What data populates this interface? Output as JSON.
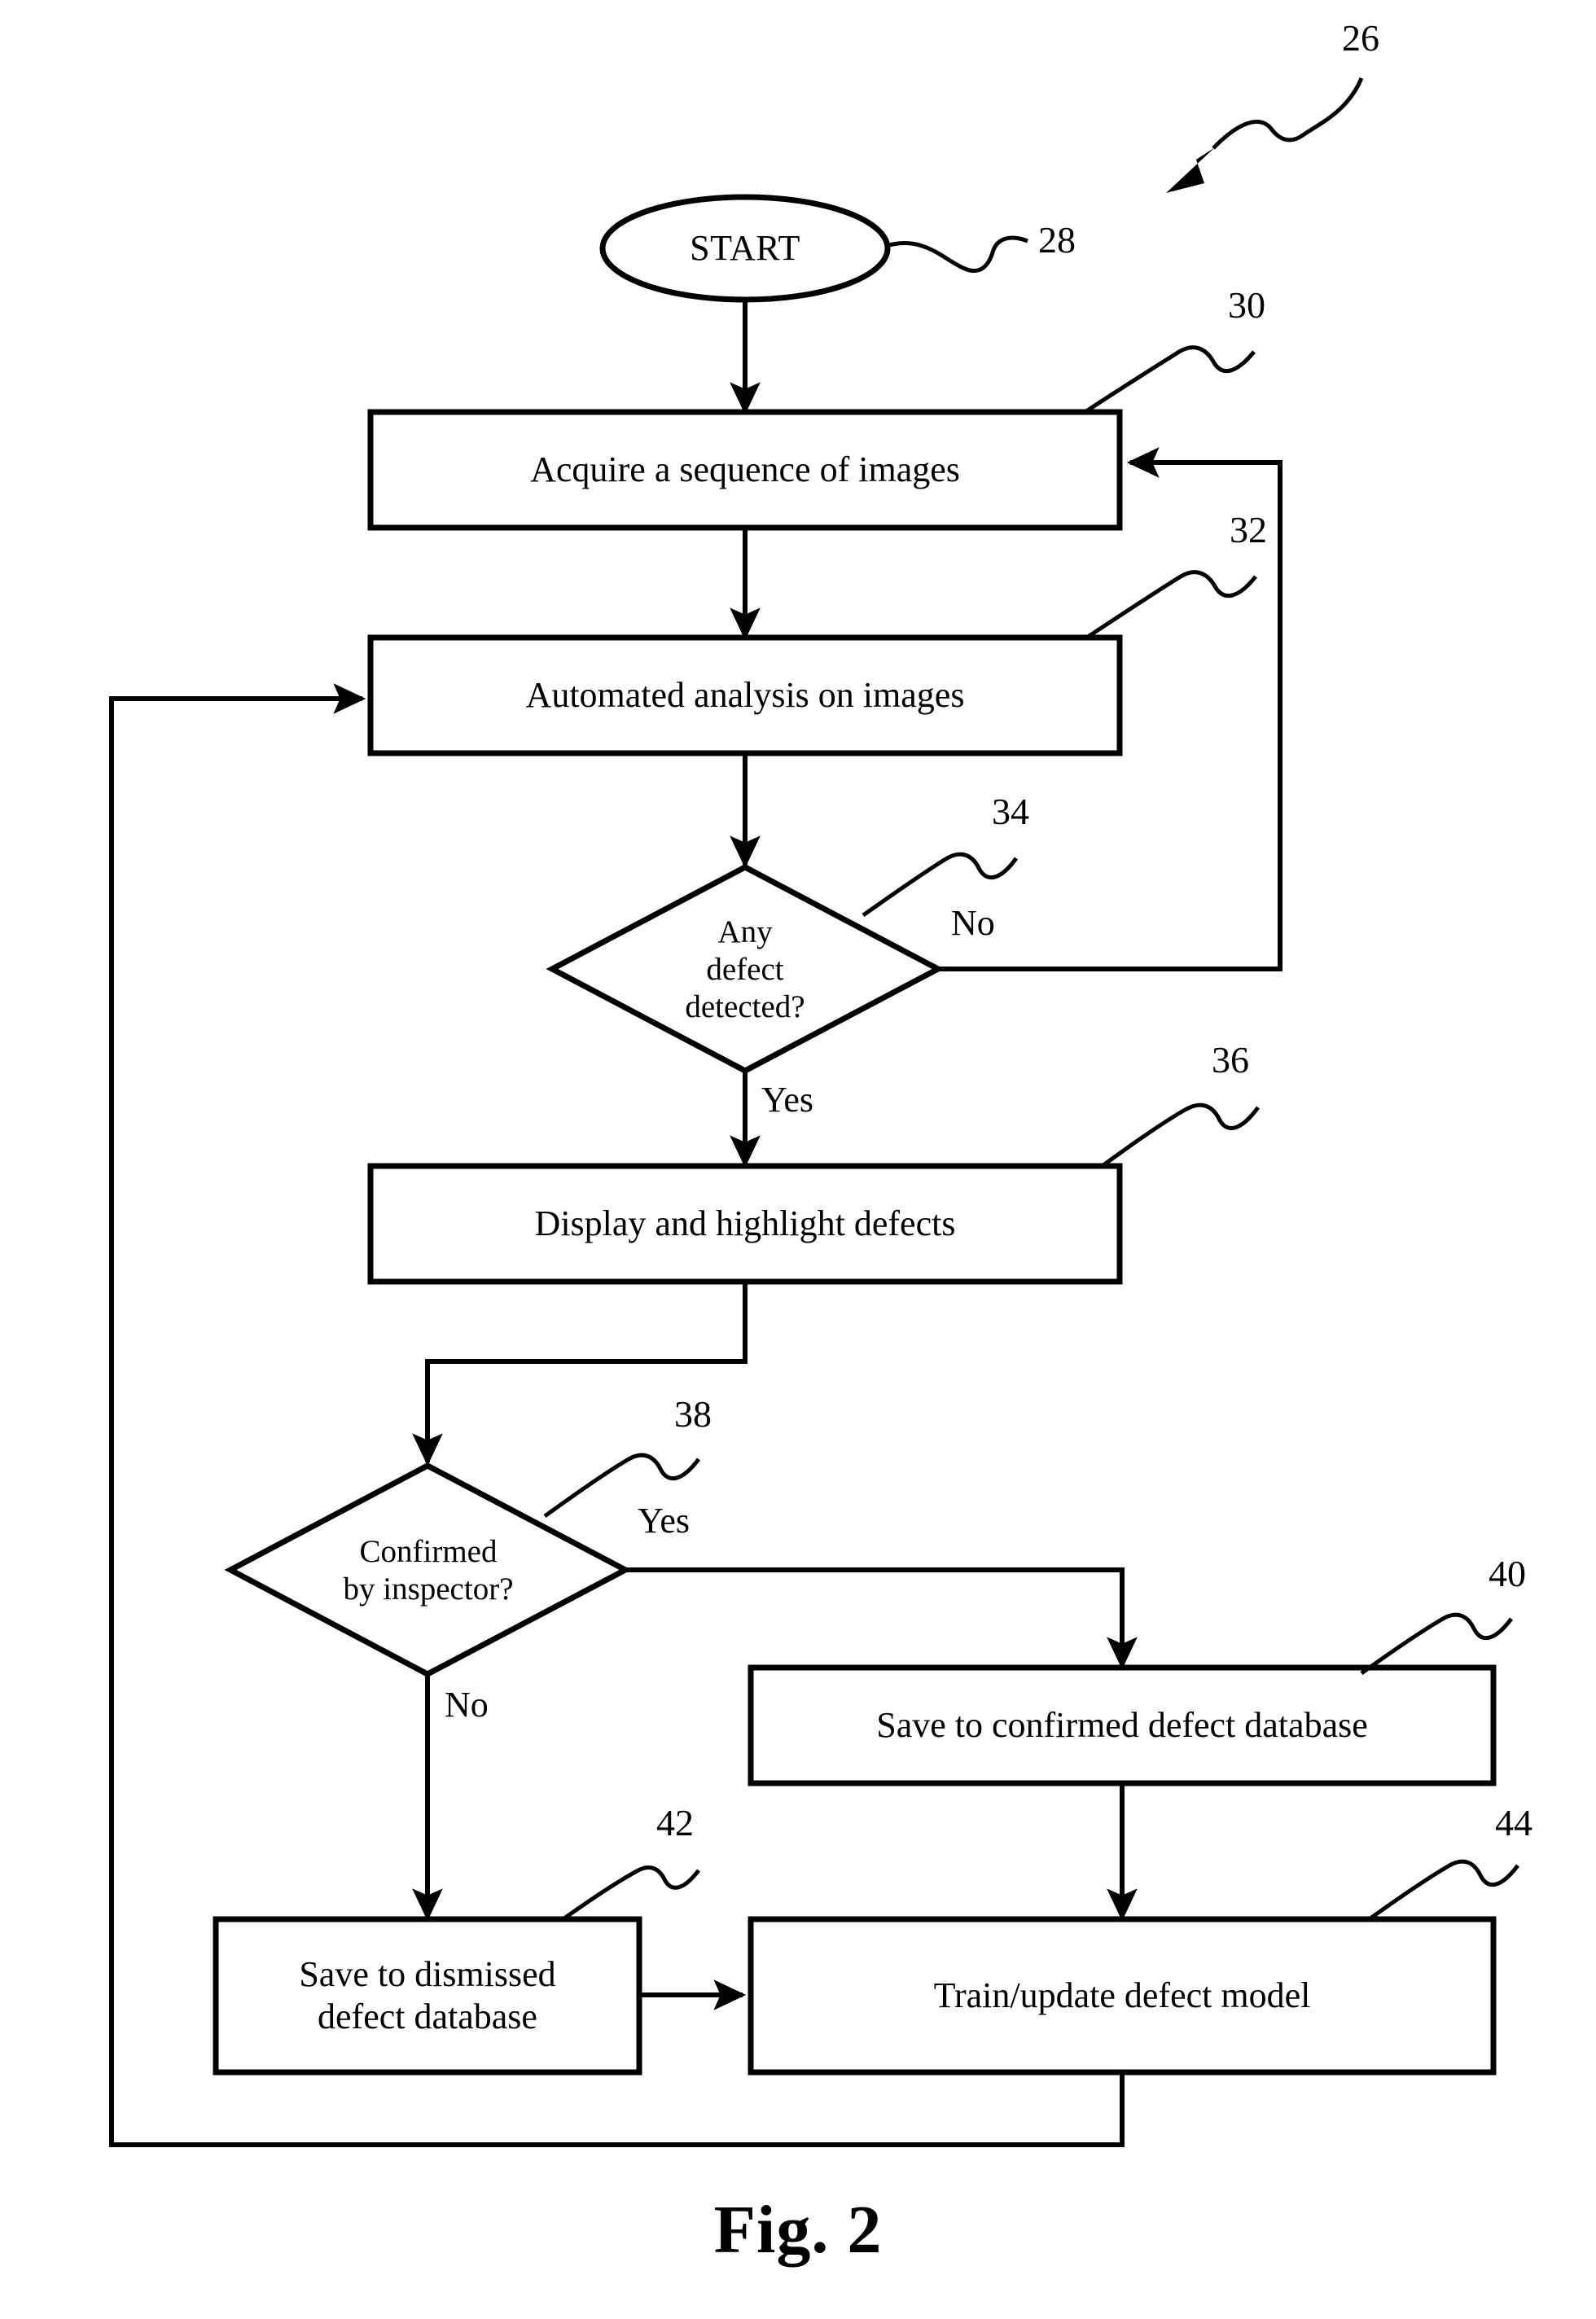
{
  "figure": {
    "caption": "Fig. 2",
    "diagram_reference": "26"
  },
  "nodes": {
    "start": {
      "label": "START",
      "ref": "28",
      "shape": "terminator"
    },
    "acquire": {
      "label": "Acquire a sequence of images",
      "ref": "30",
      "shape": "process"
    },
    "analysis": {
      "label": "Automated analysis on images",
      "ref": "32",
      "shape": "process"
    },
    "defect_check": {
      "label": "Any\ndefect\ndetected?",
      "ref": "34",
      "shape": "decision"
    },
    "display": {
      "label": "Display and highlight defects",
      "ref": "36",
      "shape": "process"
    },
    "confirm_check": {
      "label": "Confirmed\nby inspector?",
      "ref": "38",
      "shape": "decision"
    },
    "save_confirmed": {
      "label": "Save to confirmed defect database",
      "ref": "40",
      "shape": "process"
    },
    "save_dismissed": {
      "label": "Save to dismissed\ndefect database",
      "ref": "42",
      "shape": "process"
    },
    "train": {
      "label": "Train/update defect model",
      "ref": "44",
      "shape": "process"
    }
  },
  "edge_labels": {
    "defect_no": "No",
    "defect_yes": "Yes",
    "confirm_yes": "Yes",
    "confirm_no": "No"
  },
  "colors": {
    "stroke": "#000000",
    "background": "#ffffff"
  }
}
